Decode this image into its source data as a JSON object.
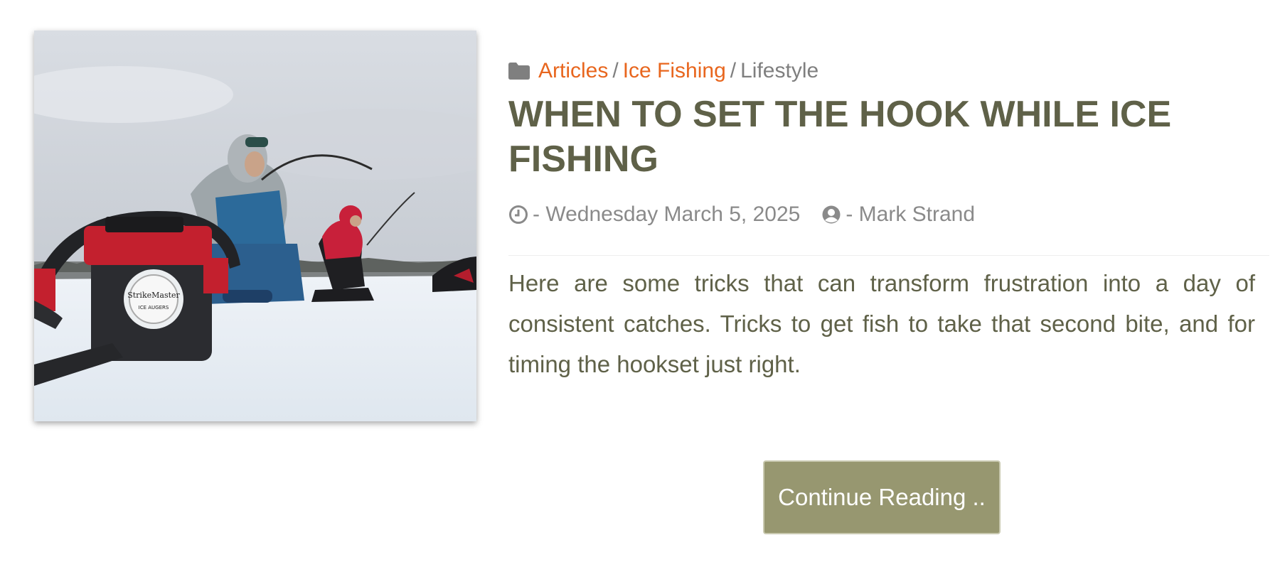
{
  "post": {
    "image_alt": "Ice anglers fishing on a frozen lake next to a StrikeMaster ice auger",
    "categories": [
      {
        "label": "Articles",
        "link": true
      },
      {
        "label": "Ice Fishing",
        "link": true
      },
      {
        "label": "Lifestyle",
        "link": false
      }
    ],
    "separator": "/",
    "title": "WHEN TO SET THE HOOK WHILE ICE FISHING",
    "date": "- Wednesday March 5, 2025",
    "author": "- Mark Strand",
    "excerpt": "Here are some tricks that can transform frustration into a day of consistent catches. Tricks to get fish to take that second bite, and for timing the hookset just right.",
    "button_label": "Continue Reading .."
  },
  "auger_brand": "StrikeMaster",
  "auger_sub": "ICE AUGERS",
  "colors": {
    "accent_link": "#e8661e",
    "title": "#5f6148",
    "button_bg": "#979770",
    "meta": "#8a8a8a"
  },
  "icons": {
    "category": "folder-icon",
    "date": "clock-icon",
    "author": "user-circle-icon"
  }
}
